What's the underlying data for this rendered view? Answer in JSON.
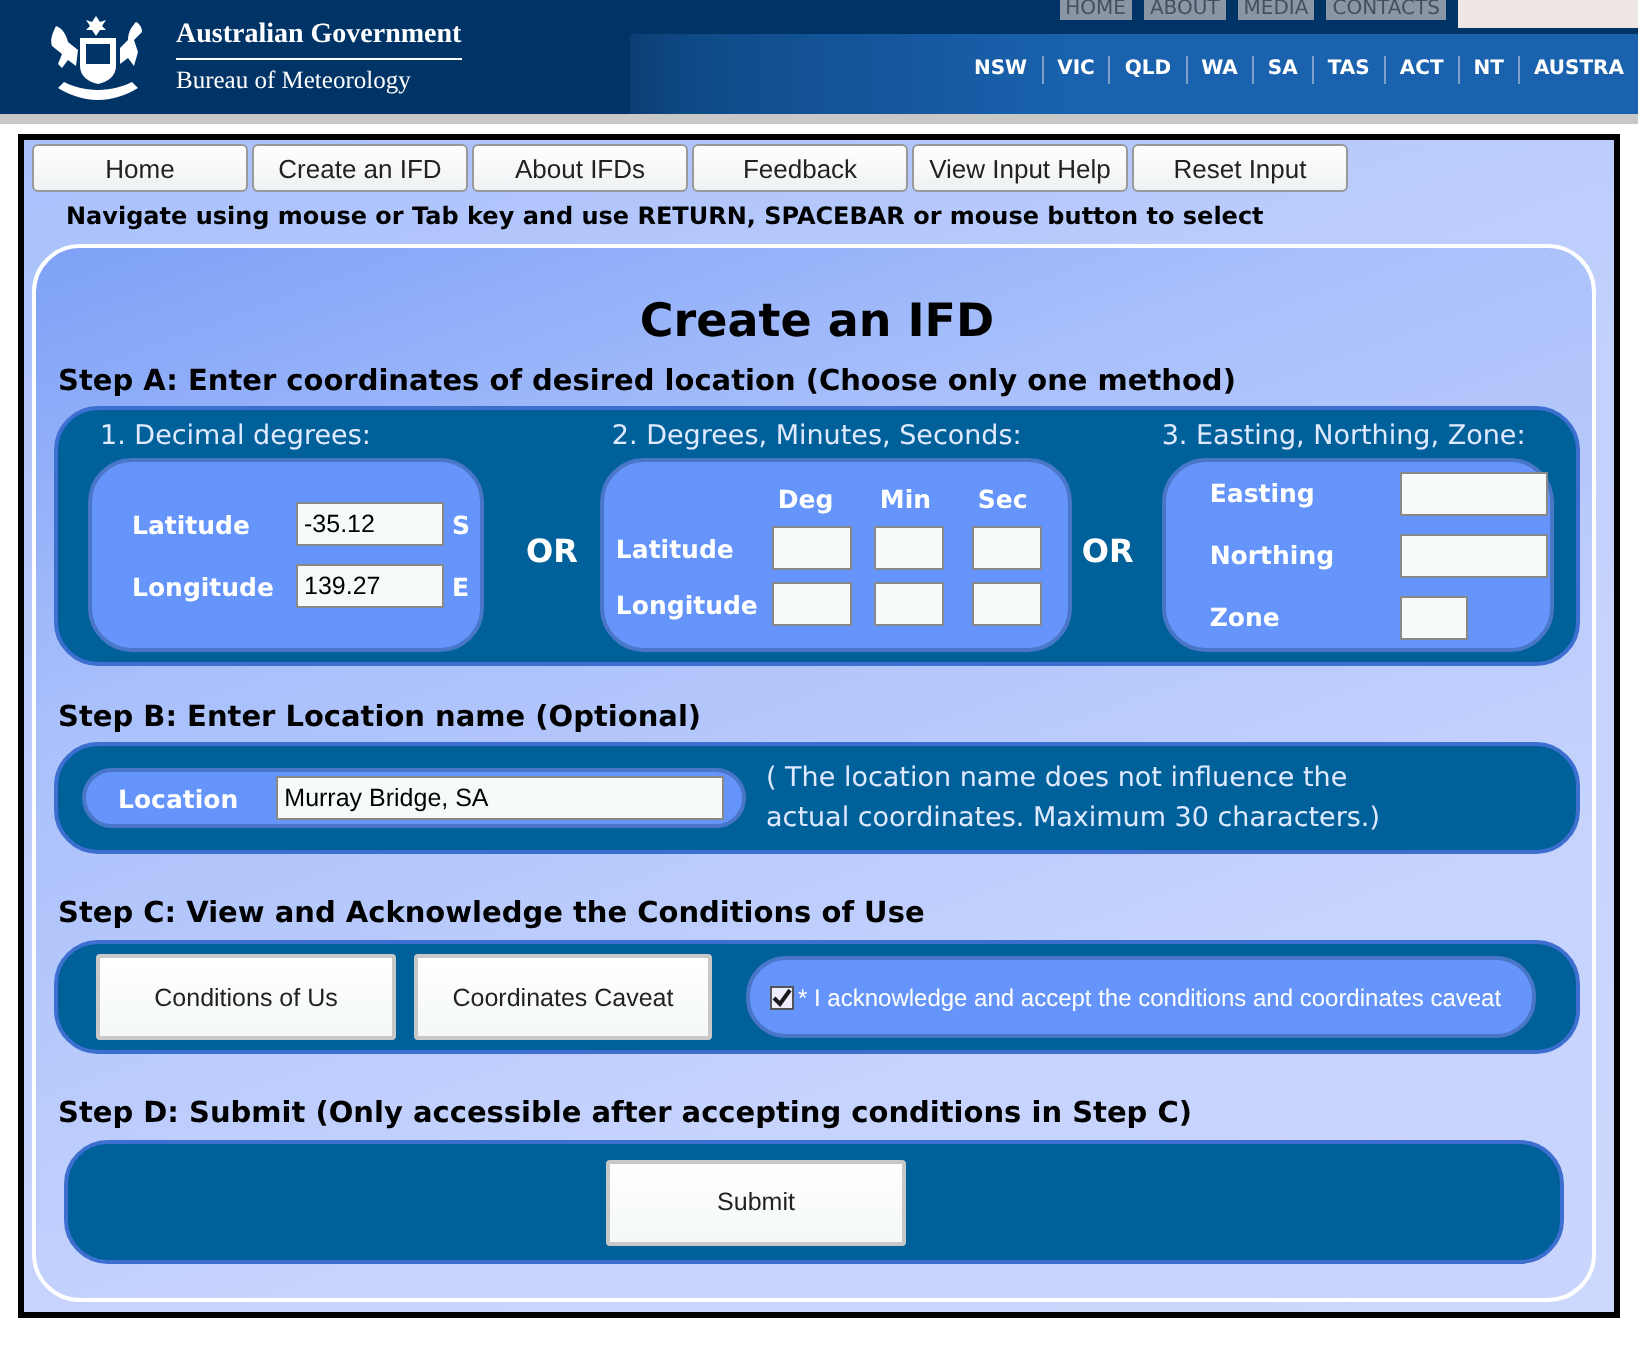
{
  "header": {
    "agency": "Australian Government",
    "bureau": "Bureau of Meteorology",
    "top_links": [
      "HOME",
      "ABOUT",
      "MEDIA",
      "CONTACTS"
    ],
    "state_links": [
      "NSW",
      "VIC",
      "QLD",
      "WA",
      "SA",
      "TAS",
      "ACT",
      "NT",
      "AUSTRA"
    ]
  },
  "nav": [
    "Home",
    "Create an IFD",
    "About IFDs",
    "Feedback",
    "View Input Help",
    "Reset Input"
  ],
  "instruction": "Navigate using mouse or Tab key and use RETURN, SPACEBAR or mouse button to select",
  "title": "Create an IFD",
  "step_a": {
    "heading": "Step A: Enter coordinates of desired location (Choose only one method)",
    "or_labels": [
      "OR",
      "OR"
    ],
    "decimal": {
      "heading": "1. Decimal degrees:",
      "rows": [
        {
          "label": "Latitude",
          "value": "-35.12",
          "suffix": "S"
        },
        {
          "label": "Longitude",
          "value": "139.27",
          "suffix": "E"
        }
      ]
    },
    "dms": {
      "heading": "2. Degrees, Minutes, Seconds:",
      "columns": [
        "Deg",
        "Min",
        "Sec"
      ],
      "rows": [
        "Latitude",
        "Longitude"
      ]
    },
    "enz": {
      "heading": "3. Easting, Northing, Zone:",
      "fields": [
        "Easting",
        "Northing",
        "Zone"
      ]
    }
  },
  "step_b": {
    "heading": "Step B: Enter Location name (Optional)",
    "label": "Location",
    "value": "Murray Bridge, SA",
    "note": "( The location name does not influence the\nactual coordinates. Maximum 30 characters.)"
  },
  "step_c": {
    "heading": "Step C: View and Acknowledge the Conditions of Use",
    "buttons": [
      "Conditions of Us",
      "Coordinates Caveat"
    ],
    "acknowledge": {
      "label": "* I acknowledge and accept the conditions and coordinates caveat",
      "checked": true
    }
  },
  "step_d": {
    "heading": "Step D: Submit (Only accessible after accepting conditions in Step C)",
    "button": "Submit"
  }
}
